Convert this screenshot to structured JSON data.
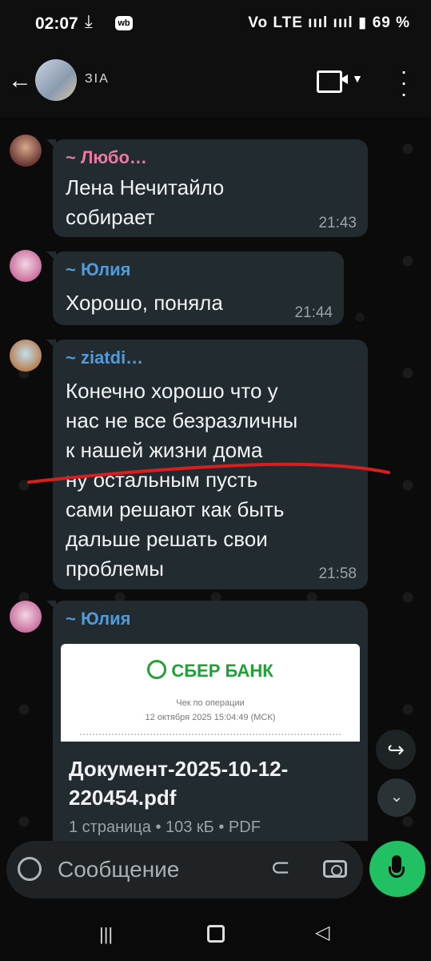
{
  "status": {
    "time": "02:07",
    "right": "Vo LTE ıııl ıııl ▮ 69 %"
  },
  "header": {
    "title": "ЗIA"
  },
  "messages": [
    {
      "name": "~ Любо…",
      "name_color": "#e77ba4",
      "text": "Лена Нечитайлo\nсобирает",
      "time": "21:43"
    },
    {
      "name": "~ Юлия",
      "name_color": "#4f9bdc",
      "text": "Хорошо, поняла",
      "time": "21:44"
    },
    {
      "name": "~ ziatdi…",
      "name_color": "#4f9bdc",
      "text": "Конечно хорошо что у\nнас не все безразличны\nк нашей жизни дома\nну остальным пусть\nсами решают как быть\nдальше решать свои\nпроблемы",
      "time": "21:58"
    },
    {
      "name": "~ Юлия",
      "name_color": "#4f9bdc"
    }
  ],
  "document": {
    "brand": "СБЕР БАНК",
    "receipt_title": "Чек по операции",
    "receipt_date": "12 октября 2025 15:04:49 (МСК)",
    "filename": "Документ-2025-10-12-\n220454.pdf",
    "meta": "1 страница • 103 кБ • PDF"
  },
  "composer": {
    "placeholder": "Сообщение"
  },
  "icons": {
    "back": "back-arrow-icon",
    "video": "video-call-icon",
    "menu": "more-vert-icon",
    "emoji": "emoji-icon",
    "attach": "attach-icon",
    "camera": "camera-icon",
    "mic": "mic-icon",
    "forward": "forward-icon",
    "scroll_down": "scroll-down-icon"
  }
}
